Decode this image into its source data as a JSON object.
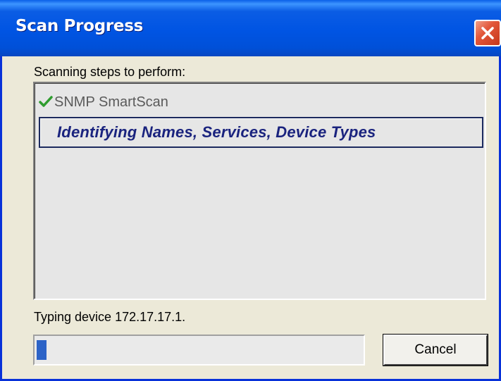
{
  "window": {
    "title": "Scan Progress",
    "close_icon": "close-icon"
  },
  "steps": {
    "label": "Scanning steps to perform:",
    "items": [
      {
        "label": "SNMP SmartScan",
        "status": "done",
        "icon": "checkmark-icon"
      },
      {
        "label": "Identifying Names, Services, Device Types",
        "status": "in-progress"
      }
    ]
  },
  "status": {
    "text": "Typing device 172.17.17.1."
  },
  "progress": {
    "fraction": 0.03
  },
  "buttons": {
    "cancel_label": "Cancel"
  },
  "colors": {
    "titlebar": "#0054e3",
    "window_bg": "#ece9d8",
    "current_step_text": "#1a237e",
    "check": "#2e9c2e",
    "progress_fill": "#2c63c7",
    "close_button": "#e2573a"
  }
}
